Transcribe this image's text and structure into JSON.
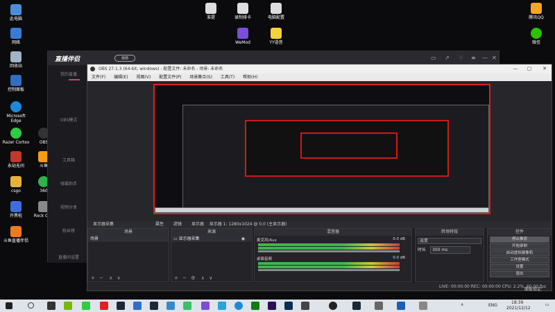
{
  "desktop_icons": {
    "this_pc": "此电脑",
    "network": "网络",
    "recycle": "回收站",
    "control_panel": "控制面板",
    "edge": "Microsoft Edge",
    "razer": "Razer Cortex",
    "obs": "OBS",
    "yongjie": "永劫无间",
    "douyu": "斗鱼",
    "csgo": "csgo",
    "n360": "360",
    "kaiheila": "开黑啦",
    "rock": "Rock Gan",
    "douyu_tool": "斗鱼直播伴侣",
    "jiuhao": "准提",
    "luzhi": "录制排卡",
    "dianjing": "电脑配置",
    "wemod": "WeMod",
    "yy": "YY语音",
    "tencent_qq": "腾讯QQ",
    "wechat": "微信"
  },
  "helper": {
    "logo": "直播伴侣",
    "badge": "画面",
    "side": [
      "我的直播",
      "OBS模式",
      "工具箱",
      "弹幕助手",
      "视频分享",
      "粉丝榜",
      "直播间设置"
    ]
  },
  "obs": {
    "title": "OBS 27.1.3 (64-bit, windows) - 配置文件: 未命名 - 场景: 未命名",
    "menu": [
      "文件(F)",
      "编辑(E)",
      "视图(V)",
      "配置文件(P)",
      "场景集合(S)",
      "工具(T)",
      "帮助(H)"
    ],
    "statusline": {
      "source": "显示器采集",
      "props": "属性",
      "filter": "滤镜",
      "display": "显示器",
      "display_value": "显示器 1: 1280x1024 @ 0,0 (主显示器)"
    },
    "scenes": {
      "header": "场景",
      "items": [
        "场景"
      ]
    },
    "sources": {
      "header": "来源",
      "items": [
        "显示器采集"
      ]
    },
    "mixer": {
      "header": "混音器",
      "channels": [
        {
          "name": "麦克风/Aux",
          "db": "0.0 dB"
        },
        {
          "name": "桌面音频",
          "db": "0.0 dB"
        }
      ]
    },
    "transition": {
      "header": "转场特效",
      "type": "淡变",
      "duration_label": "时长",
      "duration_value": "300 ms"
    },
    "controls": {
      "header": "控件",
      "buttons": [
        "停止推流",
        "开始录制",
        "启动虚拟摄像机",
        "工作室模式",
        "设置",
        "退出"
      ]
    },
    "status": "LIVE: 00:00:00   REC: 00:00:00   CPU: 2.2%, 60.00 fps",
    "bottom_right": "面板锁定"
  },
  "taskbar": {
    "lang": "ENG",
    "time": "18:39",
    "date": "2021/12/12"
  }
}
